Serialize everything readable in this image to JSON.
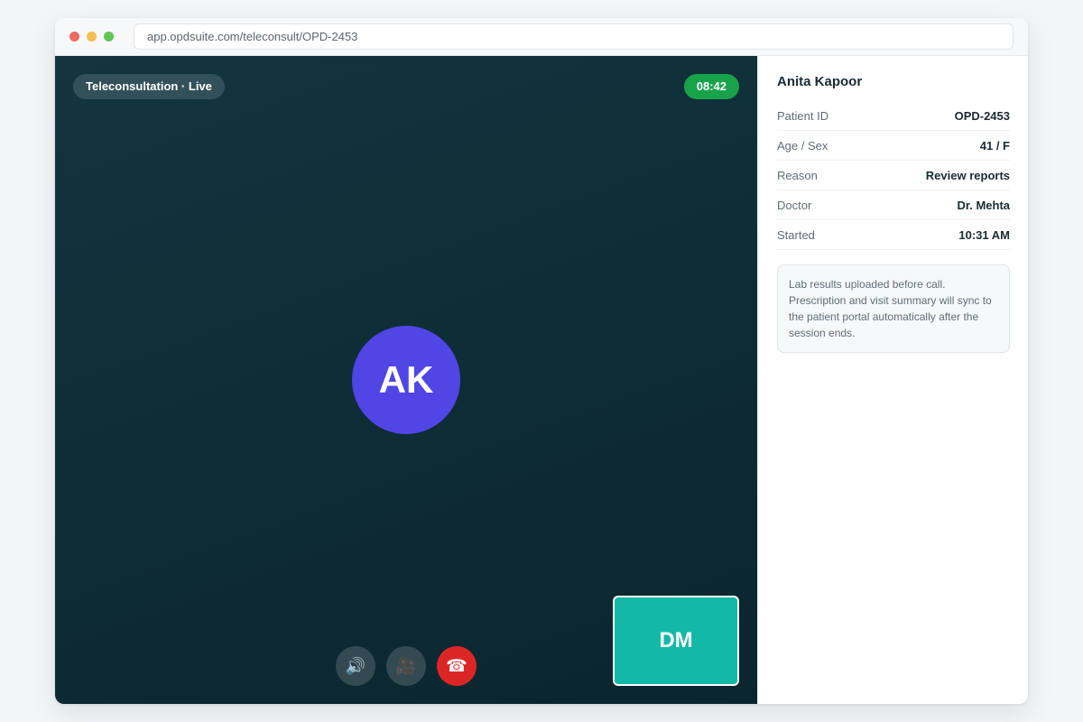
{
  "browser": {
    "url": "app.opdsuite.com/teleconsult/OPD-2453"
  },
  "call": {
    "session_label": "Teleconsultation · Live",
    "timer": "08:42",
    "patient_initials": "AK",
    "self_initials": "DM",
    "controls": {
      "audio_icon": "🔊",
      "video_icon": "🎥",
      "end_icon": "☎"
    }
  },
  "patient": {
    "name": "Anita Kapoor",
    "fields": [
      {
        "label": "Patient ID",
        "value": "OPD-2453"
      },
      {
        "label": "Age / Sex",
        "value": "41 / F"
      },
      {
        "label": "Reason",
        "value": "Review reports"
      },
      {
        "label": "Doctor",
        "value": "Dr. Mehta"
      },
      {
        "label": "Started",
        "value": "10:31 AM"
      }
    ],
    "notes": "Lab results uploaded before call. Prescription and visit summary will sync to the patient portal automatically after the session ends."
  },
  "colors": {
    "video_bg": "#0e2d36",
    "timer_green": "#18a34a",
    "patient_avatar": "#4f46e5",
    "self_view": "#14b8a6",
    "end_call": "#dc2626"
  }
}
